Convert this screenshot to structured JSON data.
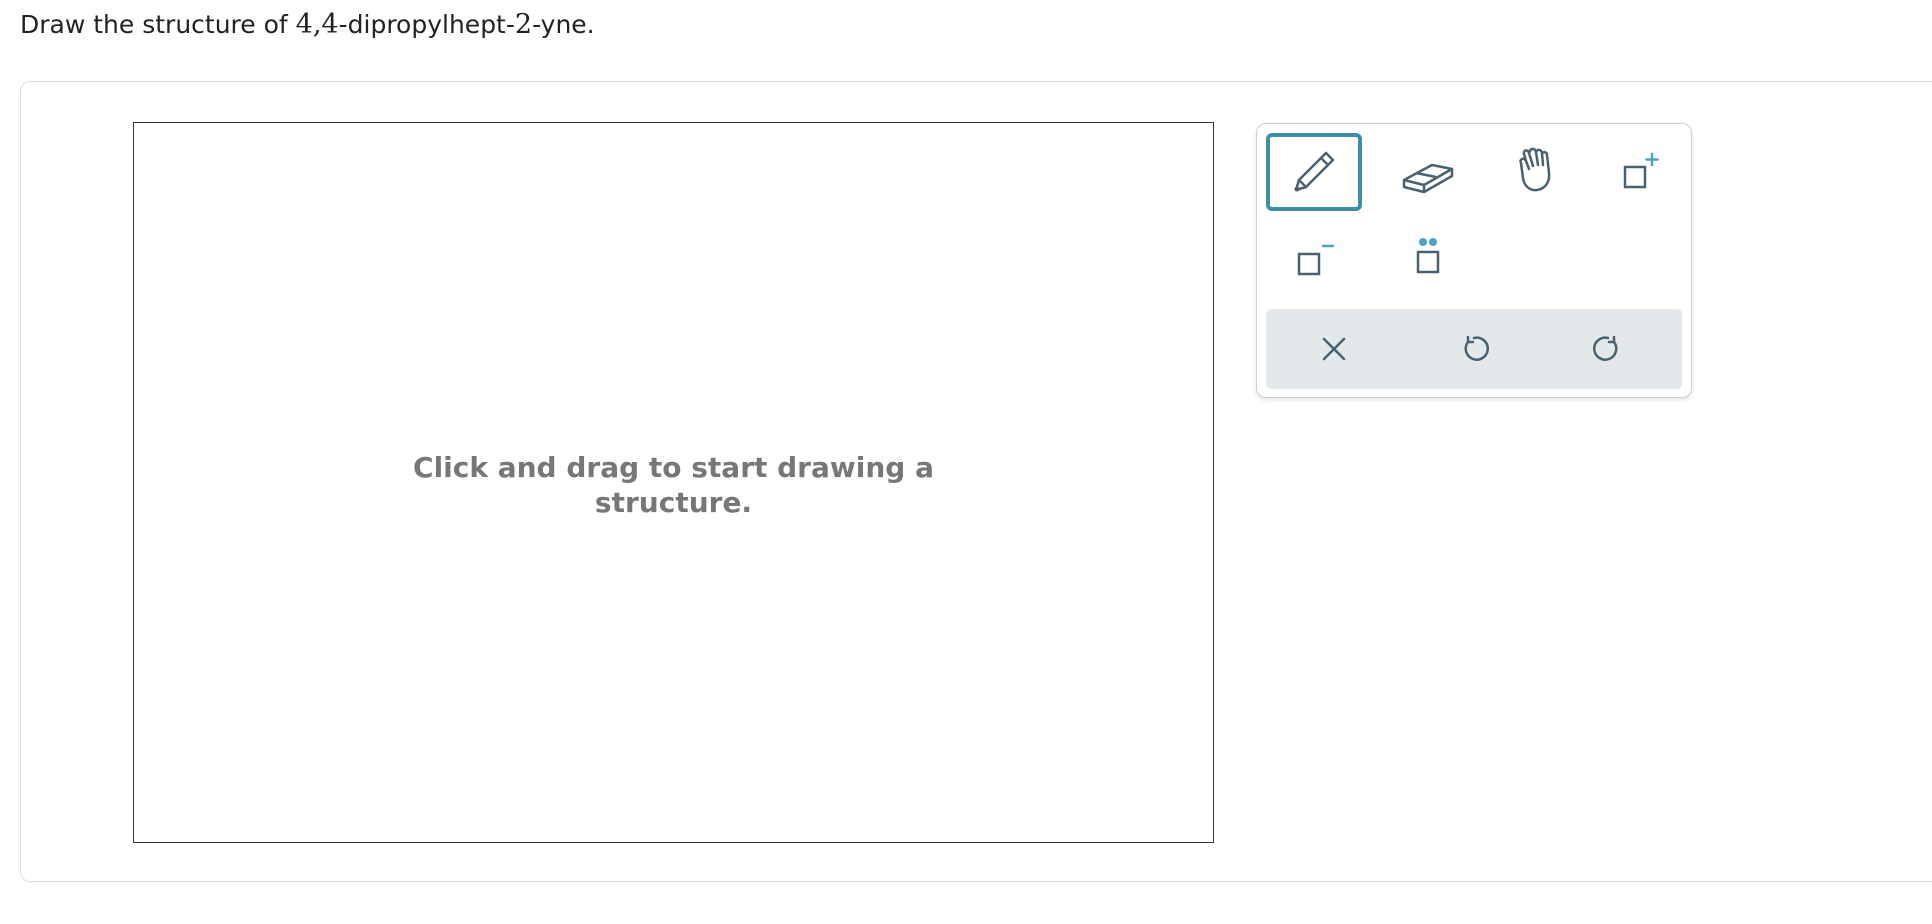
{
  "question": {
    "prefix": "Draw the structure of ",
    "name_part1": "4,4",
    "name_part2": "-dipropylhept-",
    "name_part3": "2",
    "name_part4": "-yne."
  },
  "canvas": {
    "hint_line1": "Click and drag to start drawing a",
    "hint_line2": "structure."
  },
  "toolbox": {
    "tools": [
      {
        "name": "pencil",
        "icon": "pencil-icon",
        "active": true
      },
      {
        "name": "eraser",
        "icon": "eraser-icon",
        "active": false
      },
      {
        "name": "move",
        "icon": "hand-icon",
        "active": false
      },
      {
        "name": "add-charge-positive",
        "icon": "plus-charge-icon",
        "active": false
      },
      {
        "name": "add-charge-negative",
        "icon": "minus-charge-icon",
        "active": false
      },
      {
        "name": "lone-pair",
        "icon": "lone-pair-icon",
        "active": false
      }
    ],
    "actions": [
      {
        "name": "clear",
        "icon": "close-icon"
      },
      {
        "name": "undo",
        "icon": "undo-icon"
      },
      {
        "name": "redo",
        "icon": "redo-icon"
      }
    ]
  },
  "colors": {
    "accent": "#3d8ea6",
    "icon": "#4a6270",
    "accent_light": "#4aa3c2",
    "action_bar": "#e3e8eb"
  }
}
